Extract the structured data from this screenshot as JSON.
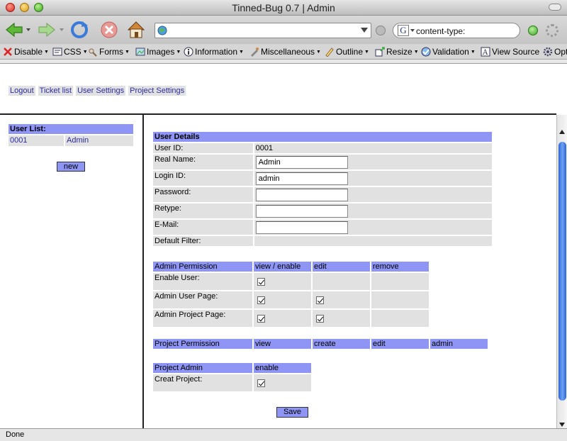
{
  "window": {
    "title": "Tinned-Bug 0.7 | Admin"
  },
  "navbar": {
    "url": "",
    "search_text": "content-type:"
  },
  "devbar": {
    "items": [
      "Disable",
      "CSS",
      "Forms",
      "Images",
      "Information",
      "Miscellaneous",
      "Outline",
      "Resize",
      "Validation",
      "View Source",
      "Opt"
    ]
  },
  "topnav": [
    "Logout",
    "Ticket list",
    "User Settings",
    "Project Settings"
  ],
  "user_list": {
    "header": "User List:",
    "rows": [
      {
        "id": "0001",
        "name": "Admin"
      }
    ],
    "new_label": "new"
  },
  "user_details": {
    "header": "User Details",
    "user_id_label": "User ID:",
    "user_id_value": "0001",
    "real_name_label": "Real Name:",
    "real_name_value": "Admin",
    "login_id_label": "Login ID:",
    "login_id_value": "admin",
    "password_label": "Password:",
    "retype_label": "Retype:",
    "email_label": "E-Mail:",
    "default_filter_label": "Default Filter:"
  },
  "admin_permission": {
    "header": "Admin Permission",
    "col_view": "view / enable",
    "col_edit": "edit",
    "col_remove": "remove",
    "rows": [
      {
        "label": "Enable User:",
        "view": true,
        "edit": false
      },
      {
        "label": "Admin User Page:",
        "view": true,
        "edit": true
      },
      {
        "label": "Admin Project Page:",
        "view": true,
        "edit": true
      }
    ]
  },
  "project_permission": {
    "header": "Project Permission",
    "cols": [
      "view",
      "create",
      "edit",
      "admin"
    ]
  },
  "project_admin": {
    "header": "Project Admin",
    "col_enable": "enable",
    "creat_project_label": "Creat Project:",
    "creat_project_checked": true
  },
  "save_label": "Save",
  "status": "Done",
  "colors": {
    "header_blue": "#8e95f5",
    "cell_gray": "#e1e1e1",
    "link_blue": "#2b2ba0"
  }
}
